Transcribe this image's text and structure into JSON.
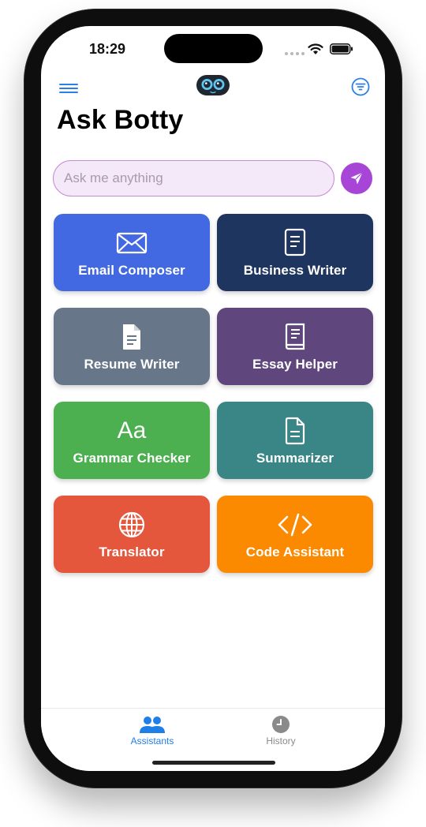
{
  "status_bar": {
    "time": "18:29"
  },
  "header": {
    "title": "Ask Botty",
    "menu_icon": "hamburger-menu-icon",
    "logo_icon": "robot-face-icon",
    "filter_icon": "filter-icon"
  },
  "search": {
    "placeholder": "Ask me anything",
    "value": ""
  },
  "colors": {
    "accent": "#a746d6",
    "tab_active": "#1f7fe6",
    "tab_inactive": "#8a8a8a"
  },
  "assistants": [
    {
      "label": "Email Composer",
      "icon": "envelope-icon",
      "color": "#4269e1"
    },
    {
      "label": "Business Writer",
      "icon": "document-icon",
      "color": "#1e355f"
    },
    {
      "label": "Resume Writer",
      "icon": "file-text-icon",
      "color": "#687689"
    },
    {
      "label": "Essay Helper",
      "icon": "book-icon",
      "color": "#5f477d"
    },
    {
      "label": "Grammar Checker",
      "icon": "Aa",
      "color": "#4caf50"
    },
    {
      "label": "Summarizer",
      "icon": "document-lines-icon",
      "color": "#3a8586"
    },
    {
      "label": "Translator",
      "icon": "globe-icon",
      "color": "#e4573d"
    },
    {
      "label": "Code Assistant",
      "icon": "code-icon",
      "color": "#fc8a00"
    }
  ],
  "tabs": [
    {
      "label": "Assistants",
      "icon": "people-icon",
      "active": true
    },
    {
      "label": "History",
      "icon": "clock-icon",
      "active": false
    }
  ]
}
